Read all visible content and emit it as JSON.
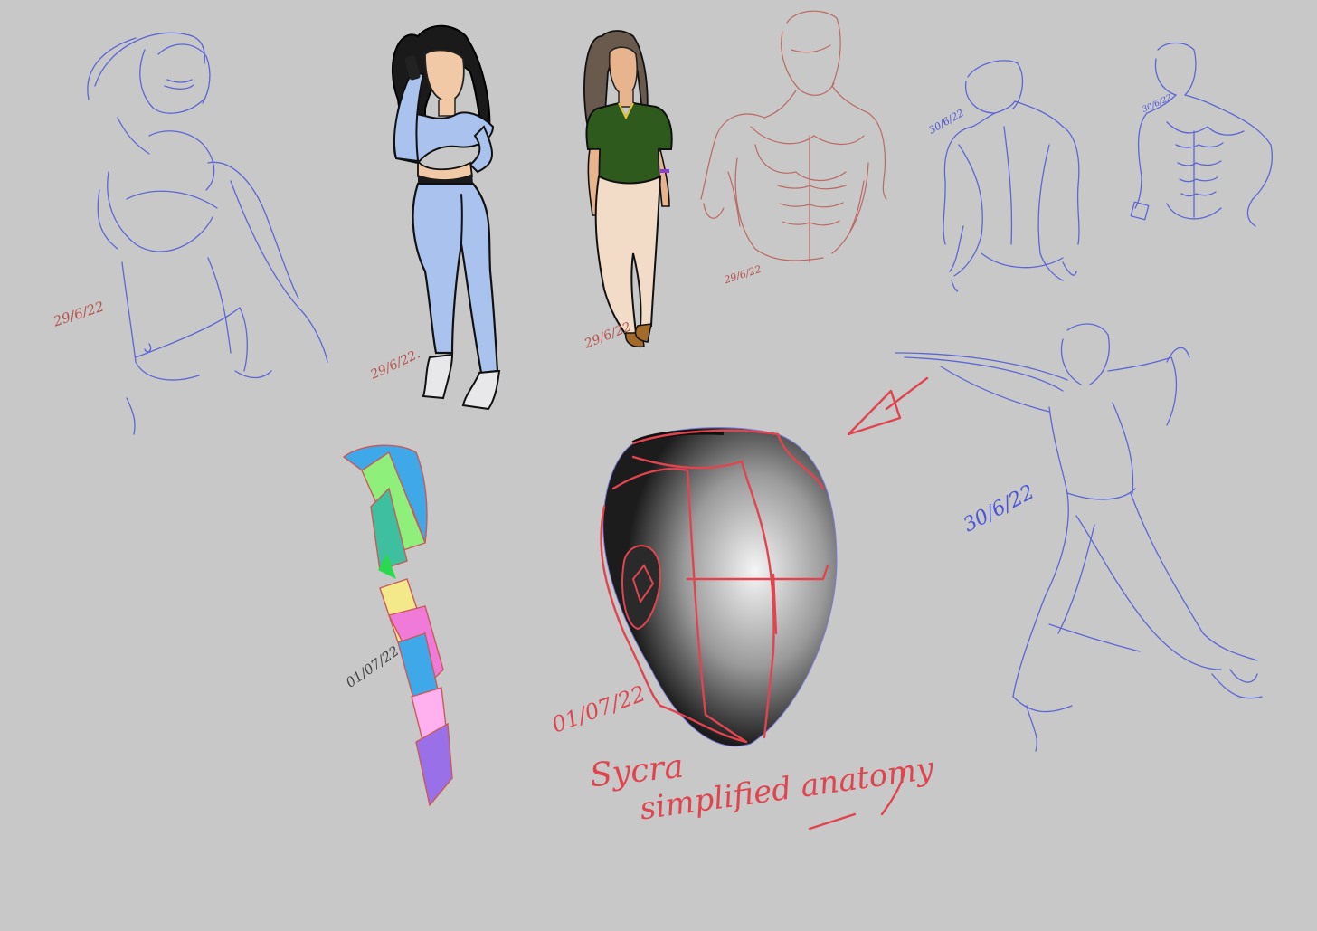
{
  "background_color": "#c8c8c8",
  "dates": {
    "d1": "29/6/22",
    "d2": "29/6/22.",
    "d3": "29/6/22",
    "d4": "29/6/22",
    "d5": "30/6/22",
    "d6": "30/6/22",
    "d7": "30/6/22",
    "d8": "01/07/22",
    "d9": "01/07/22"
  },
  "caption": {
    "line1": "Sycra",
    "line2": "simplified anatomy"
  },
  "colors": {
    "sketch_blue": "#4a55d8",
    "sketch_red": "#b8524a",
    "handwriting_red": "#e0454f",
    "shirt_blue": "#a9c2ee",
    "shirt_green": "#2f5a1e",
    "pants_cream": "#f2dcc8",
    "arm_cyan": "#3ea8e8",
    "arm_green": "#8ef07a",
    "arm_pink": "#f07ad8",
    "arm_violet": "#9a70e8"
  }
}
